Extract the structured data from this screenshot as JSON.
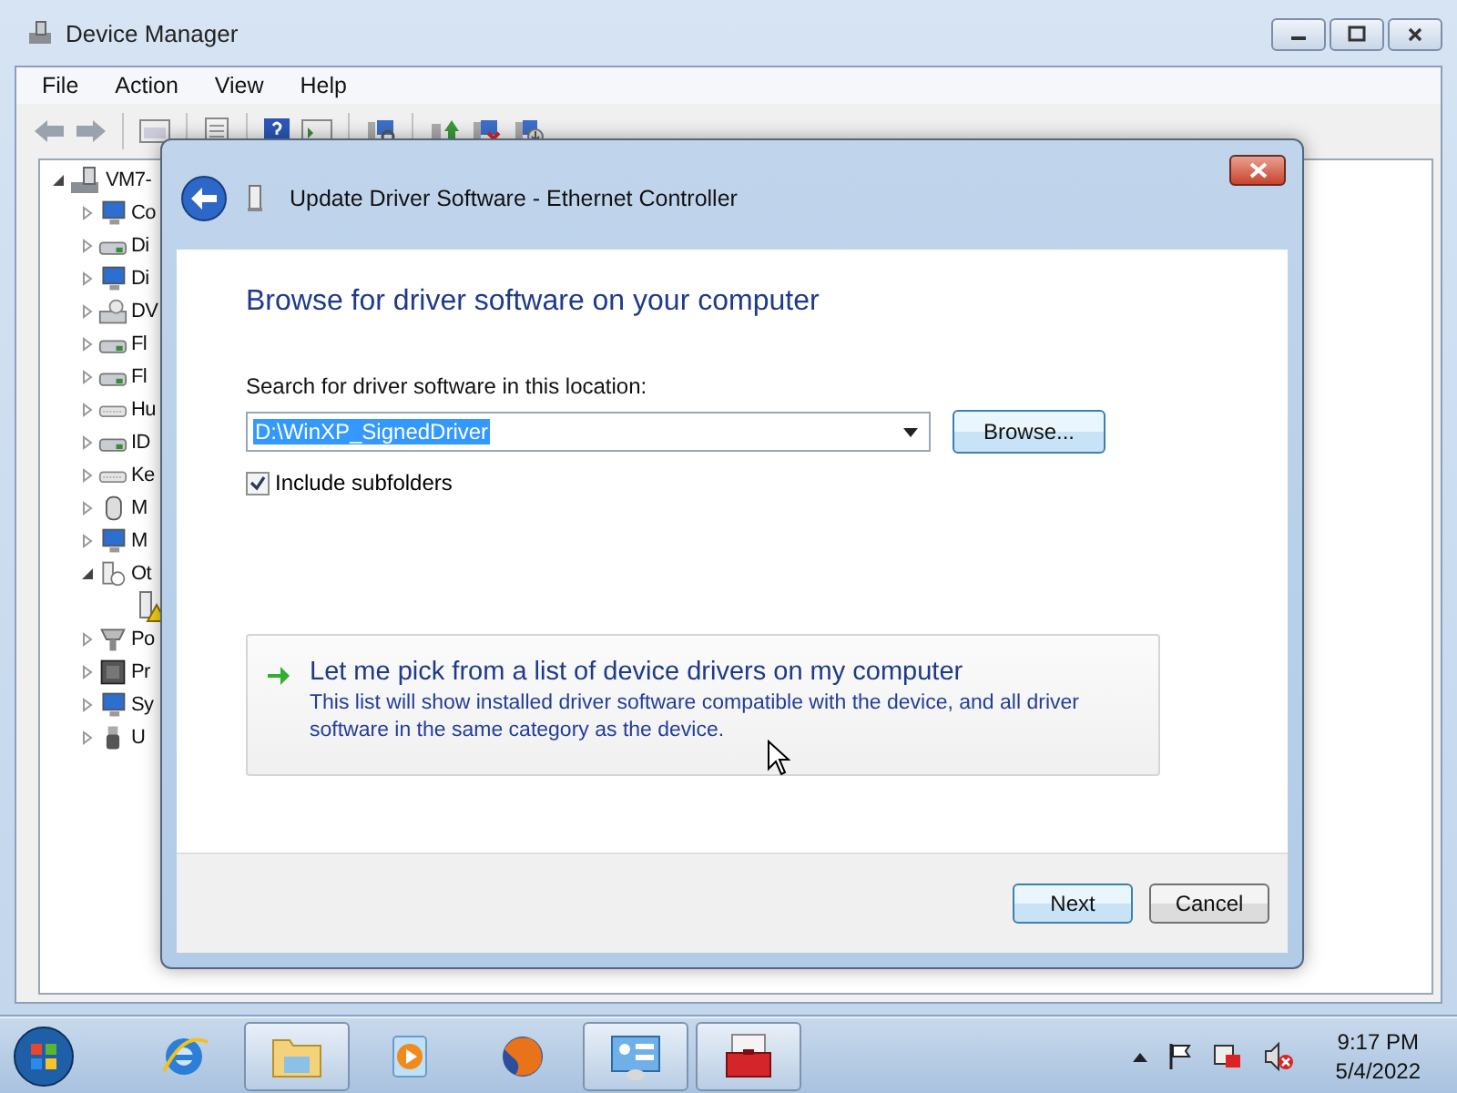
{
  "window": {
    "title": "Device Manager"
  },
  "menu": [
    "File",
    "Action",
    "View",
    "Help"
  ],
  "tree": {
    "label": "VM7-",
    "expanded": true,
    "children": [
      {
        "label": "Co",
        "expanded": false
      },
      {
        "label": "Di",
        "expanded": false
      },
      {
        "label": "Di",
        "expanded": false
      },
      {
        "label": "DV",
        "expanded": false
      },
      {
        "label": "Fl",
        "expanded": false
      },
      {
        "label": "Fl",
        "expanded": false
      },
      {
        "label": "Hu",
        "expanded": false
      },
      {
        "label": "ID",
        "expanded": false
      },
      {
        "label": "Ke",
        "expanded": false
      },
      {
        "label": "M",
        "expanded": false
      },
      {
        "label": "M",
        "expanded": false
      },
      {
        "label": "Ot",
        "expanded": true,
        "children": [
          {
            "warning": true
          }
        ]
      },
      {
        "label": "Po",
        "expanded": false
      },
      {
        "label": "Pr",
        "expanded": false
      },
      {
        "label": "Sy",
        "expanded": false
      },
      {
        "label": "U",
        "expanded": false
      }
    ]
  },
  "dialog": {
    "title": "Update Driver Software - Ethernet Controller",
    "heading": "Browse for driver software on your computer",
    "location_label": "Search for driver software in this location:",
    "location_value": "D:\\WinXP_SignedDriver",
    "browse_button": "Browse...",
    "include_subfolders": {
      "label": "Include subfolders",
      "checked": true
    },
    "pick_option": {
      "title": "Let me pick from a list of device drivers on my computer",
      "description": "This list will show installed driver software compatible with the device, and all driver software in the same category as the device."
    },
    "buttons": [
      {
        "label": "Next",
        "default": true
      },
      {
        "label": "Cancel",
        "default": false
      }
    ]
  },
  "taskbar": {
    "items": [
      {
        "kind": "browser",
        "running": false
      },
      {
        "kind": "folder",
        "running": true
      },
      {
        "kind": "media",
        "running": false
      },
      {
        "kind": "globe",
        "running": false
      },
      {
        "kind": "control-panel",
        "running": true
      },
      {
        "kind": "toolbox",
        "running": true
      }
    ],
    "time": "9:17 PM",
    "date": "5/4/2022"
  }
}
